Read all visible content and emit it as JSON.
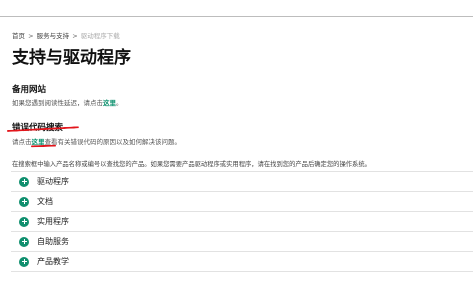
{
  "breadcrumb": {
    "items": [
      "首页",
      "服务与支持",
      "驱动程序下载"
    ],
    "separator": ">"
  },
  "page": {
    "title": "支持与驱动程序"
  },
  "alt_site": {
    "heading": "备用网站",
    "desc_prefix": "如果您遇到阅读性延迟，请点击",
    "link": "这里",
    "desc_suffix": "。"
  },
  "error_search": {
    "heading": "错误代码搜索",
    "desc_prefix": "请点击",
    "link": "这里",
    "desc_suffix": "查看有关错误代码的原因以及如何解决该问题。"
  },
  "instruction": "在搜索框中输入产品名称或编号以查找您的产品。如果您需要产品驱动程序或实用程序，请在找到您的产品后确定您的操作系统。",
  "accordion": {
    "items": [
      "驱动程序",
      "文档",
      "实用程序",
      "自助服务",
      "产品教学"
    ]
  },
  "colors": {
    "accent": "#0f8f6e",
    "annotation_red": "#e3161c"
  }
}
